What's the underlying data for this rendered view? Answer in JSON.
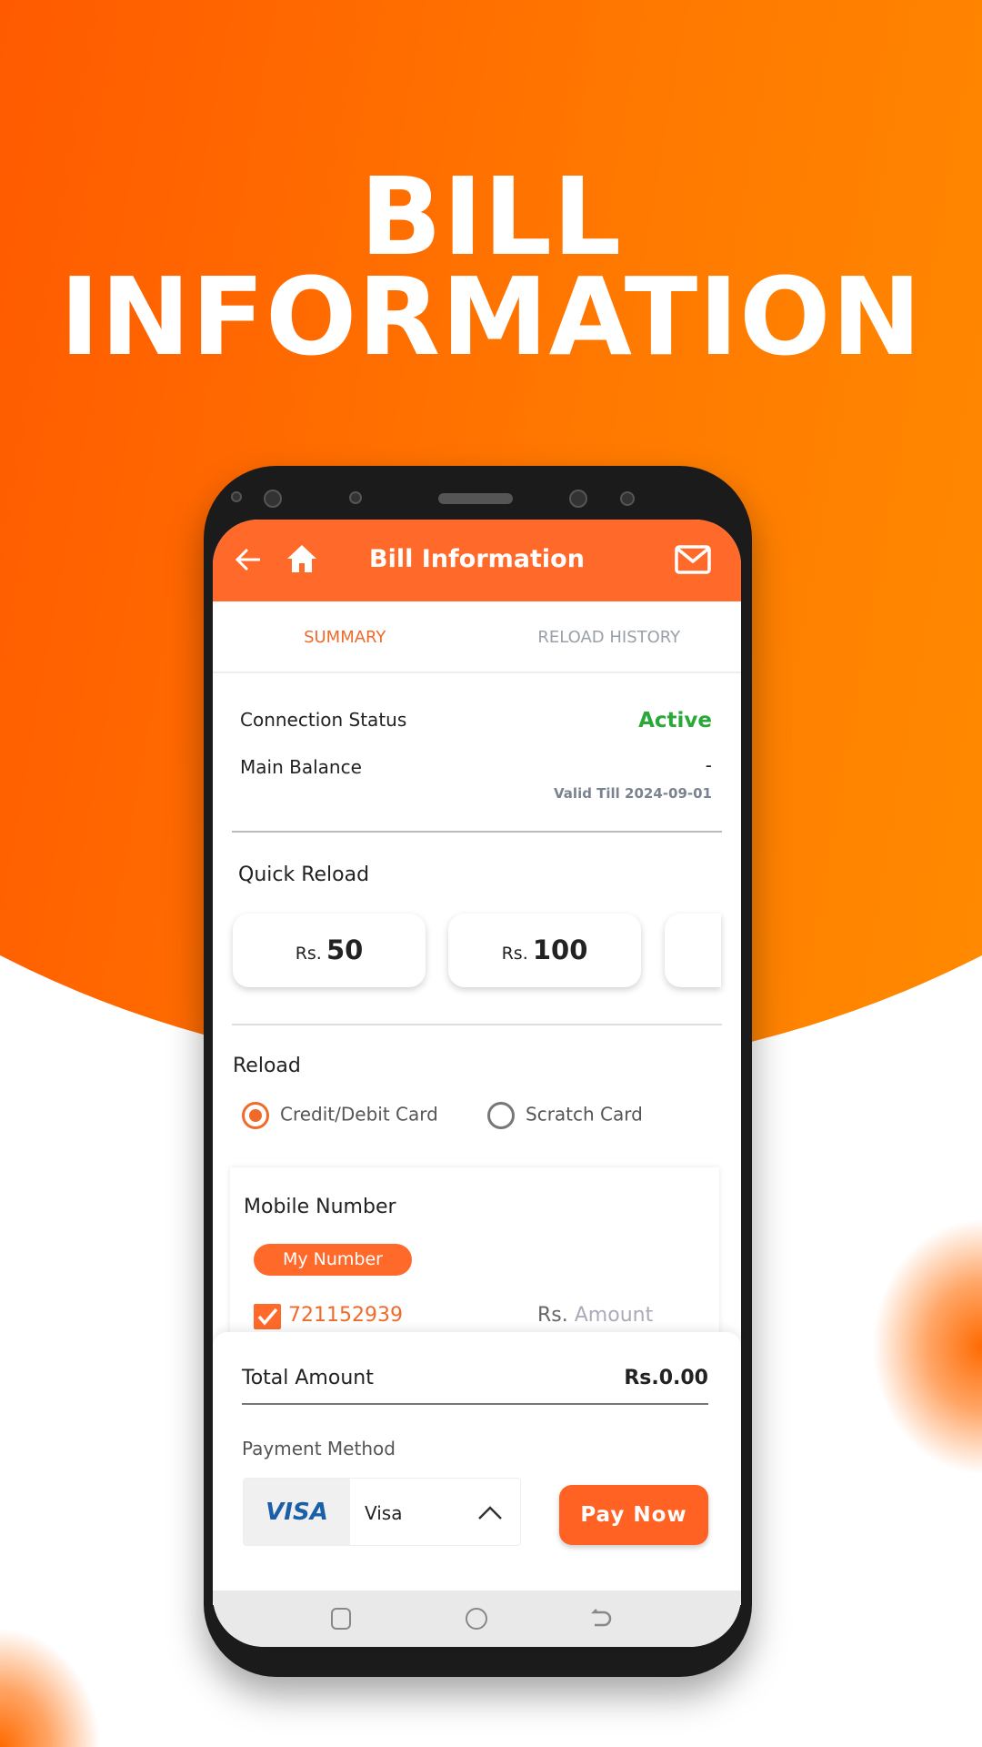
{
  "headline": {
    "line1": "BILL",
    "line2": "INFORMATION"
  },
  "colors": {
    "brand": "#ff6a2b",
    "active": "#2aa83a"
  },
  "appbar": {
    "title": "Bill Information",
    "back_icon": "arrow-left",
    "home_icon": "home",
    "mail_icon": "envelope"
  },
  "tabs": [
    {
      "label": "SUMMARY",
      "active": true
    },
    {
      "label": "RELOAD HISTORY",
      "active": false
    }
  ],
  "summary": {
    "connection_label": "Connection Status",
    "connection_value": "Active",
    "balance_label": "Main Balance",
    "balance_value": "-",
    "valid_till": "Valid Till 2024-09-01"
  },
  "quick_reload": {
    "title": "Quick Reload",
    "options": [
      {
        "currency": "Rs.",
        "amount": "50"
      },
      {
        "currency": "Rs.",
        "amount": "100"
      }
    ]
  },
  "reload": {
    "title": "Reload",
    "methods": [
      {
        "label": "Credit/Debit Card",
        "selected": true
      },
      {
        "label": "Scratch Card",
        "selected": false
      }
    ]
  },
  "mobile": {
    "title": "Mobile Number",
    "pill": "My Number",
    "number": "721152939",
    "checked": true,
    "currency": "Rs.",
    "amount_placeholder": "Amount"
  },
  "total": {
    "label": "Total Amount",
    "value": "Rs.0.00"
  },
  "payment": {
    "label": "Payment Method",
    "card_logo": "VISA",
    "selected": "Visa",
    "pay_button": "Pay Now"
  }
}
